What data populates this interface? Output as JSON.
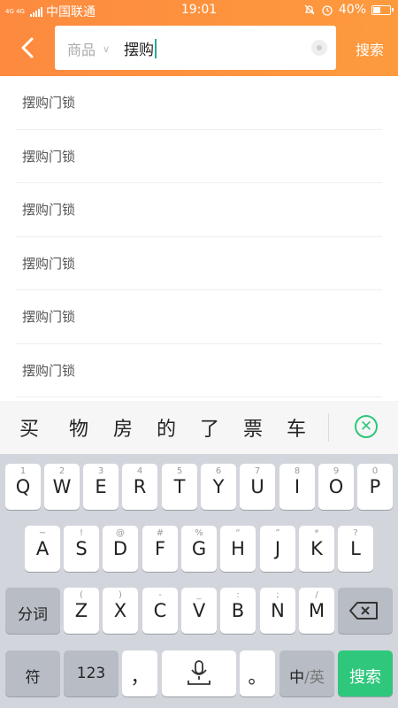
{
  "status": {
    "carrier": "中国联通",
    "network": "4G 4G",
    "time": "19:01",
    "battery": "40%"
  },
  "search": {
    "scope": "商品",
    "query": "摆购",
    "button": "搜索"
  },
  "suggestions": [
    "摆购门锁",
    "摆购门锁",
    "摆购门锁",
    "摆购门锁",
    "摆购门锁",
    "摆购门锁"
  ],
  "keyboard": {
    "candidates": [
      "买",
      "物",
      "房",
      "的",
      "了",
      "票",
      "车"
    ],
    "row1": [
      {
        "k": "Q",
        "s": "1"
      },
      {
        "k": "W",
        "s": "2"
      },
      {
        "k": "E",
        "s": "3"
      },
      {
        "k": "R",
        "s": "4"
      },
      {
        "k": "T",
        "s": "5"
      },
      {
        "k": "Y",
        "s": "6"
      },
      {
        "k": "U",
        "s": "7"
      },
      {
        "k": "I",
        "s": "8"
      },
      {
        "k": "O",
        "s": "9"
      },
      {
        "k": "P",
        "s": "0"
      }
    ],
    "row2": [
      {
        "k": "A",
        "s": "~"
      },
      {
        "k": "S",
        "s": "!"
      },
      {
        "k": "D",
        "s": "@"
      },
      {
        "k": "F",
        "s": "#"
      },
      {
        "k": "G",
        "s": "%"
      },
      {
        "k": "H",
        "s": "“"
      },
      {
        "k": "J",
        "s": "”"
      },
      {
        "k": "K",
        "s": "*"
      },
      {
        "k": "L",
        "s": "?"
      }
    ],
    "row3": [
      {
        "k": "Z",
        "s": "("
      },
      {
        "k": "X",
        "s": ")"
      },
      {
        "k": "C",
        "s": "-"
      },
      {
        "k": "V",
        "s": "_"
      },
      {
        "k": "B",
        "s": ":"
      },
      {
        "k": "N",
        "s": ";"
      },
      {
        "k": "M",
        "s": "/"
      }
    ],
    "fenci": "分词",
    "symbols": "符",
    "numbers": "123",
    "comma": "，",
    "period": "。",
    "lang_cn": "中",
    "lang_sep": "/",
    "lang_en": "英",
    "enter": "搜索"
  },
  "colors": {
    "accent": "#fd8a3f",
    "keyboard_green": "#2ec77b",
    "caret": "#26a89a"
  }
}
